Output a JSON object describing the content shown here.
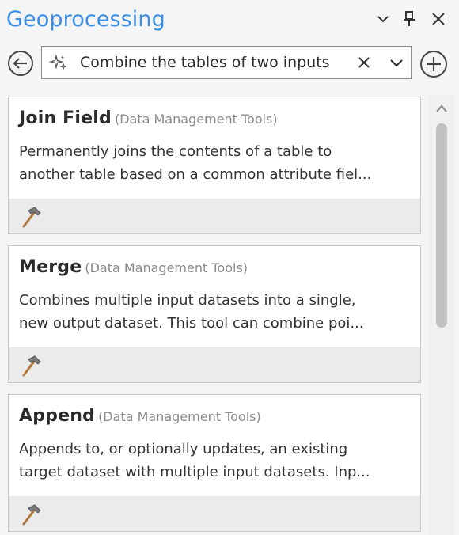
{
  "header": {
    "title": "Geoprocessing"
  },
  "search": {
    "value": "Combine the tables of two inputs"
  },
  "results": [
    {
      "name": "Join Field",
      "toolbox": "(Data Management Tools)",
      "description_lines": [
        "Permanently joins the contents of a table to",
        "another table based on a common attribute fiel..."
      ]
    },
    {
      "name": "Merge",
      "toolbox": "(Data Management Tools)",
      "description_lines": [
        "Combines multiple input datasets into a single,",
        "new output dataset. This tool can combine poi..."
      ]
    },
    {
      "name": "Append",
      "toolbox": "(Data Management Tools)",
      "description_lines": [
        "Appends to, or optionally updates, an existing",
        "target dataset with multiple input datasets. Inp..."
      ]
    }
  ],
  "icons": {
    "back": "back-arrow-icon",
    "sparkle": "sparkle-icon",
    "clear": "close-icon",
    "dropdown": "chevron-down-icon",
    "add": "plus-circle-icon",
    "tool": "hammer-icon",
    "pin": "pin-icon",
    "options": "chevron-down-icon",
    "close": "close-icon"
  },
  "colors": {
    "title": "#3a8ee6",
    "card_footer": "#ebebeb",
    "scroll_thumb": "#c2c2c2"
  }
}
